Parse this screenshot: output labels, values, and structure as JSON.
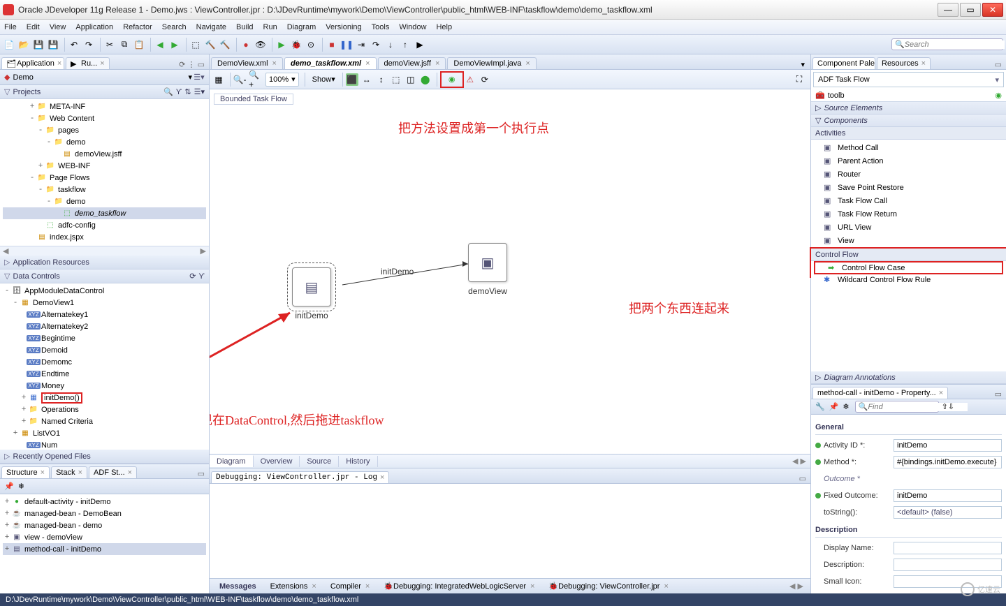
{
  "window": {
    "title": "Oracle JDeveloper 11g Release 1 - Demo.jws : ViewController.jpr : D:\\JDevRuntime\\mywork\\Demo\\ViewController\\public_html\\WEB-INF\\taskflow\\demo\\demo_taskflow.xml"
  },
  "menus": [
    "File",
    "Edit",
    "View",
    "Application",
    "Refactor",
    "Search",
    "Navigate",
    "Build",
    "Run",
    "Diagram",
    "Versioning",
    "Tools",
    "Window",
    "Help"
  ],
  "search_placeholder": "Search",
  "left": {
    "app_tabs": [
      {
        "label": "Application",
        "icon": "app-icon",
        "active": true
      },
      {
        "label": "Ru...",
        "icon": "run-icon",
        "active": false
      }
    ],
    "app_selector": "Demo",
    "projects_header": "Projects",
    "tree": [
      {
        "depth": 3,
        "tw": "+",
        "icon": "folder",
        "label": "META-INF"
      },
      {
        "depth": 3,
        "tw": "-",
        "icon": "folder",
        "label": "Web Content"
      },
      {
        "depth": 4,
        "tw": "-",
        "icon": "folder",
        "label": "pages"
      },
      {
        "depth": 5,
        "tw": "-",
        "icon": "folder",
        "label": "demo"
      },
      {
        "depth": 6,
        "tw": " ",
        "icon": "jsff",
        "label": "demoView.jsff"
      },
      {
        "depth": 4,
        "tw": "+",
        "icon": "folder",
        "label": "WEB-INF"
      },
      {
        "depth": 3,
        "tw": "-",
        "icon": "folder",
        "label": "Page Flows"
      },
      {
        "depth": 4,
        "tw": "-",
        "icon": "folder",
        "label": "taskflow"
      },
      {
        "depth": 5,
        "tw": "-",
        "icon": "folder",
        "label": "demo"
      },
      {
        "depth": 6,
        "tw": " ",
        "icon": "tf",
        "label": "demo_taskflow",
        "sel": true,
        "italic": true
      },
      {
        "depth": 4,
        "tw": " ",
        "icon": "tf",
        "label": "adfc-config"
      },
      {
        "depth": 3,
        "tw": " ",
        "icon": "jspx",
        "label": "index.jspx"
      }
    ],
    "acc_app_resources": "Application Resources",
    "acc_data_controls": "Data Controls",
    "dc_tree": [
      {
        "depth": 0,
        "tw": "-",
        "icon": "dc",
        "label": "AppModuleDataControl"
      },
      {
        "depth": 1,
        "tw": "-",
        "icon": "vo",
        "label": "DemoView1"
      },
      {
        "depth": 2,
        "tw": " ",
        "icon": "xyz",
        "label": "Alternatekey1"
      },
      {
        "depth": 2,
        "tw": " ",
        "icon": "xyz",
        "label": "Alternatekey2"
      },
      {
        "depth": 2,
        "tw": " ",
        "icon": "xyz",
        "label": "Begintime"
      },
      {
        "depth": 2,
        "tw": " ",
        "icon": "xyz",
        "label": "Demoid"
      },
      {
        "depth": 2,
        "tw": " ",
        "icon": "xyz",
        "label": "Demomc"
      },
      {
        "depth": 2,
        "tw": " ",
        "icon": "xyz",
        "label": "Endtime"
      },
      {
        "depth": 2,
        "tw": " ",
        "icon": "xyz",
        "label": "Money"
      },
      {
        "depth": 2,
        "tw": "+",
        "icon": "method",
        "label": "initDemo()",
        "boxed": true
      },
      {
        "depth": 2,
        "tw": "+",
        "icon": "folder",
        "label": "Operations"
      },
      {
        "depth": 2,
        "tw": "+",
        "icon": "folder",
        "label": "Named Criteria"
      },
      {
        "depth": 1,
        "tw": "+",
        "icon": "vo",
        "label": "ListVO1"
      },
      {
        "depth": 2,
        "tw": " ",
        "icon": "xyz",
        "label": "Num"
      }
    ],
    "acc_recent": "Recently Opened Files",
    "structure_tabs": [
      {
        "label": "Structure",
        "active": true
      },
      {
        "label": "Stack",
        "active": false
      },
      {
        "label": "ADF St...",
        "active": false
      }
    ],
    "structure_tree": [
      {
        "depth": 0,
        "tw": "+",
        "icon": "dot-g",
        "label": "default-activity - initDemo"
      },
      {
        "depth": 0,
        "tw": "+",
        "icon": "bean",
        "label": "managed-bean - DemoBean"
      },
      {
        "depth": 0,
        "tw": "+",
        "icon": "bean",
        "label": "managed-bean - demo"
      },
      {
        "depth": 0,
        "tw": "+",
        "icon": "view",
        "label": "view - demoView"
      },
      {
        "depth": 0,
        "tw": "+",
        "icon": "mc",
        "label": "method-call - initDemo",
        "sel": true
      }
    ]
  },
  "center": {
    "editor_tabs": [
      {
        "label": "DemoView.xml",
        "active": false
      },
      {
        "label": "demo_taskflow.xml",
        "active": true
      },
      {
        "label": "demoView.jsff",
        "active": false
      },
      {
        "label": "DemoViewImpl.java",
        "active": false
      }
    ],
    "zoom": "100%",
    "show_label": "Show",
    "bft": "Bounded Task Flow",
    "node_initDemo": "initDemo",
    "node_demoView": "demoView",
    "flow_label": "initDemo",
    "bottom_tabs": [
      "Diagram",
      "Overview",
      "Source",
      "History"
    ],
    "log_tab": "Debugging: ViewController.jpr - Log",
    "annotations": {
      "top": "把方法设置成第一个执行点",
      "right": "把两个东西连起来",
      "bottom": "刚写的方法会出现在DataControl,然后拖进taskflow"
    }
  },
  "right": {
    "palette_tabs": [
      {
        "label": "Component Palette",
        "active": true
      },
      {
        "label": "Resources",
        "active": false
      }
    ],
    "palette_selector": "ADF Task Flow",
    "toolb": "toolb",
    "groups": {
      "source": "Source Elements",
      "components": "Components",
      "activities": "Activities",
      "controlflow": "Control Flow",
      "diagann": "Diagram Annotations"
    },
    "activities": [
      "Method Call",
      "Parent Action",
      "Router",
      "Save Point Restore",
      "Task Flow Call",
      "Task Flow Return",
      "URL View",
      "View"
    ],
    "controlflows": [
      {
        "label": "Control Flow Case",
        "boxed": true
      },
      {
        "label": "Wildcard Control Flow Rule",
        "boxed": false
      }
    ],
    "prop_tab": "method-call - initDemo - Property...",
    "prop_find": "Find",
    "sect_general": "General",
    "prop_activity": "Activity ID *:",
    "prop_activity_v": "initDemo",
    "prop_method": "Method *:",
    "prop_method_v": "#{bindings.initDemo.execute}",
    "prop_outcome": "Outcome *",
    "prop_fixed": "Fixed Outcome:",
    "prop_fixed_v": "initDemo",
    "prop_tostring": "toString():",
    "prop_tostring_v": "<default> (false)",
    "sect_desc": "Description",
    "prop_display": "Display Name:",
    "prop_description": "Description:",
    "prop_smallicon": "Small Icon:"
  },
  "msgtabs": [
    {
      "label": "Messages",
      "bold": true
    },
    {
      "label": "Extensions"
    },
    {
      "label": "Compiler"
    },
    {
      "label": "Debugging: IntegratedWebLogicServer"
    },
    {
      "label": "Debugging: ViewController.jpr"
    }
  ],
  "statusbar": "D:\\JDevRuntime\\mywork\\Demo\\ViewController\\public_html\\WEB-INF\\taskflow\\demo\\demo_taskflow.xml",
  "watermark": "亿速云"
}
